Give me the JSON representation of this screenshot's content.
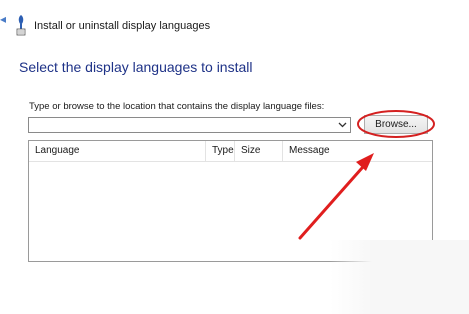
{
  "window": {
    "title": "Install or uninstall display languages"
  },
  "page": {
    "heading": "Select the display languages to install"
  },
  "path_field": {
    "label": "Type or browse to the location that contains the display language files:",
    "value": "",
    "placeholder": ""
  },
  "browse_button": {
    "label": "Browse..."
  },
  "language_list": {
    "columns": [
      "Language",
      "Type",
      "Size",
      "Message"
    ],
    "rows": []
  },
  "icons": {
    "app_icon": "language-icon",
    "back_arrow": "back-arrow-icon",
    "dropdown": "chevron-down-icon"
  },
  "annotation": {
    "circle_color": "#d42020",
    "arrow_color": "#e01e1e"
  }
}
